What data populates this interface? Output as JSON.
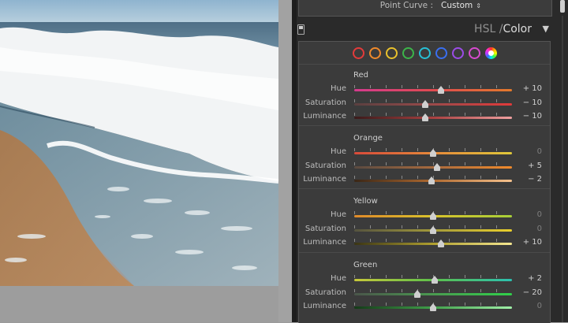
{
  "tone_curve": {
    "label": "Point Curve :",
    "value": "Custom"
  },
  "hsl_panel": {
    "title_parts": [
      "HSL",
      "/",
      "Color"
    ],
    "swatch_colors": [
      "#e33b3b",
      "#f08a2b",
      "#e9c12c",
      "#3cb54a",
      "#27c0d6",
      "#3a6ff0",
      "#9b4ce8",
      "#d84bd1"
    ],
    "groups": [
      {
        "name": "Red",
        "rows": [
          {
            "label": "Hue",
            "value": "+ 10",
            "fraction": 0.55,
            "gradient": [
              "#d43b8e",
              "#e04a50",
              "#e37a2c"
            ]
          },
          {
            "label": "Saturation",
            "value": "− 10",
            "fraction": 0.45,
            "gradient": [
              "#5a4040",
              "#9b4a4a",
              "#e23a3a"
            ]
          },
          {
            "label": "Luminance",
            "value": "− 10",
            "fraction": 0.45,
            "gradient": [
              "#3a1a1a",
              "#a84040",
              "#f0a0a0"
            ]
          }
        ]
      },
      {
        "name": "Orange",
        "rows": [
          {
            "label": "Hue",
            "value": "0",
            "fraction": 0.5,
            "gradient": [
              "#d84a3a",
              "#e6893a",
              "#e0c83a"
            ]
          },
          {
            "label": "Saturation",
            "value": "+ 5",
            "fraction": 0.525,
            "gradient": [
              "#5a4a40",
              "#a86a3e",
              "#f08a2b"
            ]
          },
          {
            "label": "Luminance",
            "value": "− 2",
            "fraction": 0.49,
            "gradient": [
              "#3a2616",
              "#b06a30",
              "#f5c28e"
            ]
          }
        ]
      },
      {
        "name": "Yellow",
        "rows": [
          {
            "label": "Hue",
            "value": "0",
            "fraction": 0.5,
            "gradient": [
              "#e08a2a",
              "#d8c22c",
              "#a8cf38"
            ]
          },
          {
            "label": "Saturation",
            "value": "0",
            "fraction": 0.5,
            "gradient": [
              "#55533f",
              "#a39a3a",
              "#e9cf2c"
            ]
          },
          {
            "label": "Luminance",
            "value": "+ 10",
            "fraction": 0.55,
            "gradient": [
              "#3a3414",
              "#b0a030",
              "#f4e690"
            ]
          }
        ]
      },
      {
        "name": "Green",
        "rows": [
          {
            "label": "Hue",
            "value": "+ 2",
            "fraction": 0.51,
            "gradient": [
              "#c8c83a",
              "#5cc04a",
              "#2cc0b0"
            ]
          },
          {
            "label": "Saturation",
            "value": "− 20",
            "fraction": 0.4,
            "gradient": [
              "#4a554a",
              "#4a9a50",
              "#30d04a"
            ]
          },
          {
            "label": "Luminance",
            "value": "0",
            "fraction": 0.5,
            "gradient": [
              "#143a18",
              "#40a04a",
              "#a0f0a8"
            ]
          }
        ]
      }
    ]
  }
}
